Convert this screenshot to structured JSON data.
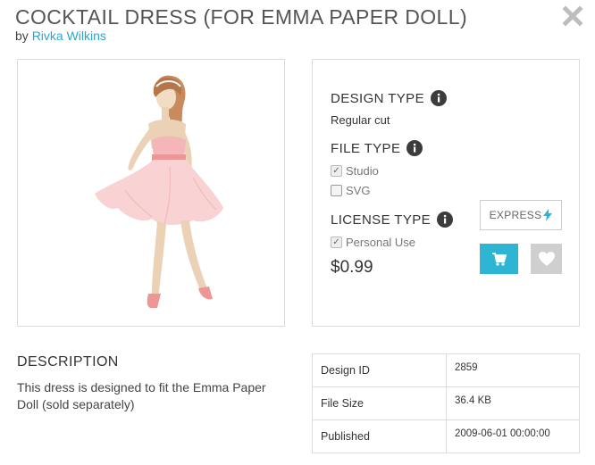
{
  "product": {
    "title": "COCKTAIL DRESS (FOR EMMA PAPER DOLL)",
    "by_prefix": "by",
    "designer": "Rivka Wilkins"
  },
  "design_type": {
    "label": "DESIGN TYPE",
    "value": "Regular cut"
  },
  "file_type": {
    "label": "FILE TYPE",
    "options": [
      {
        "label": "Studio",
        "checked": true
      },
      {
        "label": "SVG",
        "checked": false
      }
    ]
  },
  "license_type": {
    "label": "LICENSE TYPE",
    "options": [
      {
        "label": "Personal Use",
        "checked": true
      }
    ]
  },
  "price": "$0.99",
  "actions": {
    "express_label": "EXPRESS"
  },
  "description": {
    "heading": "DESCRIPTION",
    "text": "This dress is designed to fit the Emma Paper Doll (sold separately)"
  },
  "meta": {
    "rows": [
      {
        "key": "Design ID",
        "value": "2859"
      },
      {
        "key": "File Size",
        "value": "36.4 KB"
      },
      {
        "key": "Published",
        "value": "2009-06-01 00:00:00"
      }
    ]
  },
  "colors": {
    "accent": "#2fb5d4",
    "link": "#2aa7cf",
    "dress": "#f7c9c9"
  }
}
